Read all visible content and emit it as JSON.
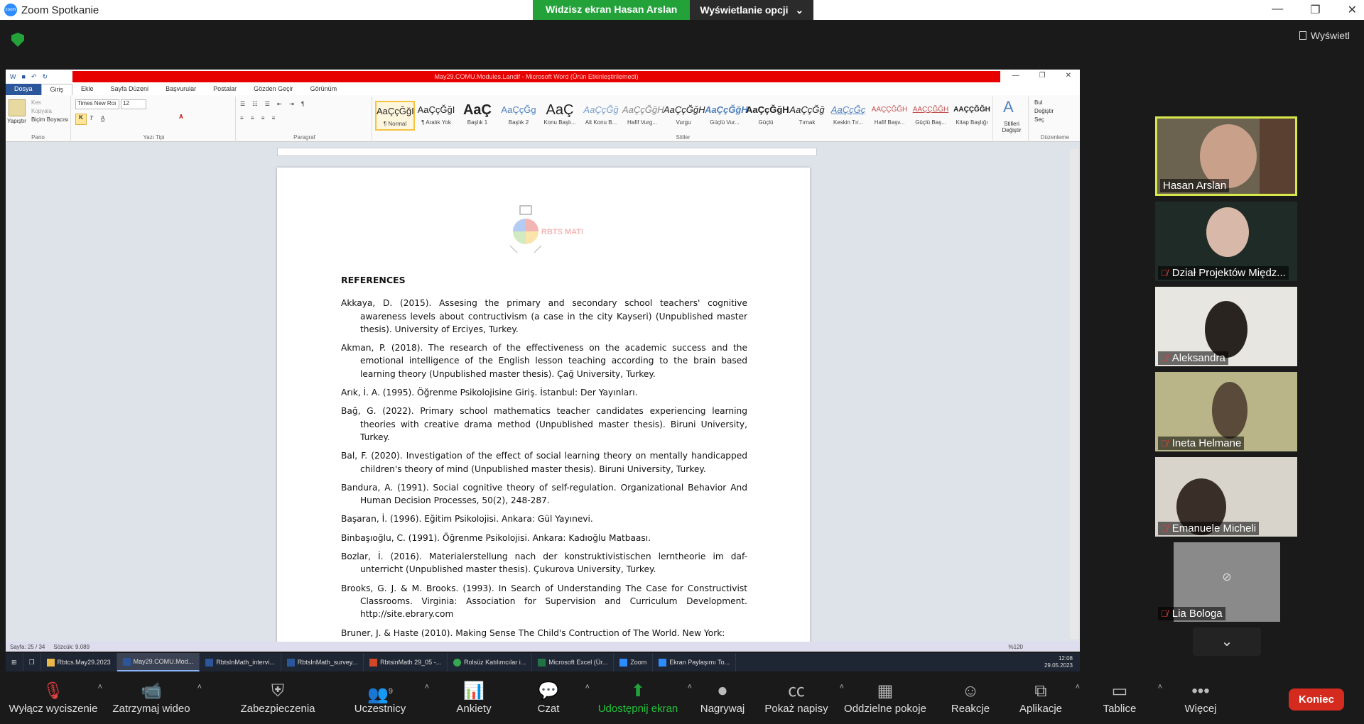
{
  "app": {
    "title": "Zoom Spotkanie"
  },
  "share_banner": {
    "viewing": "Widzisz ekran Hasan Arslan",
    "options": "Wyświetlanie opcji"
  },
  "view_button": "Wyświetl",
  "word": {
    "title": "May29.COMU.Modules.Landif - Microsoft Word (Ürün Etkinleştirilemedi)",
    "tabs": [
      "Dosya",
      "Giriş",
      "Ekle",
      "Sayfa Düzeni",
      "Başvurular",
      "Postalar",
      "Gözden Geçir",
      "Görünüm"
    ],
    "clipboard": {
      "paste": "Yapıştır",
      "cut": "Kes",
      "copy": "Kopyala",
      "format_painter": "Biçim Boyacısı",
      "group": "Pano"
    },
    "font": {
      "name": "Times New Roı",
      "size": "12",
      "group": "Yazı Tipi"
    },
    "paragraph_group": "Paragraf",
    "styles": [
      {
        "preview": "AaÇçĞğI",
        "name": "¶ Normal"
      },
      {
        "preview": "AaÇçĞğI",
        "name": "¶ Aralık Yok"
      },
      {
        "preview": "AaÇ",
        "name": "Başlık 1"
      },
      {
        "preview": "AaÇçĞg",
        "name": "Başlık 2"
      },
      {
        "preview": "AaÇ",
        "name": "Konu Başlı..."
      },
      {
        "preview": "AaÇçĞğ",
        "name": "Alt Konu B..."
      },
      {
        "preview": "AaÇçĞğH",
        "name": "Hafif Vurg..."
      },
      {
        "preview": "AaÇçĞğH",
        "name": "Vurgu"
      },
      {
        "preview": "AaÇçĞğH",
        "name": "Güçlü Vur..."
      },
      {
        "preview": "AaÇçĞğH",
        "name": "Güçlü"
      },
      {
        "preview": "AaÇçĞğ",
        "name": "Tırnak"
      },
      {
        "preview": "AaÇçĞç",
        "name": "Keskin Tır..."
      },
      {
        "preview": "AAÇÇĞĞH",
        "name": "Hafif Başv..."
      },
      {
        "preview": "AAÇÇĞĞH",
        "name": "Güçlü Baş..."
      },
      {
        "preview": "AAÇÇĞĞH",
        "name": "Kitap Başlığı"
      }
    ],
    "styles_group": "Stiller",
    "change_styles": "Stilleri Değiştir",
    "editing": {
      "find": "Bul",
      "replace": "Değiştir",
      "select": "Seç",
      "group": "Düzenleme"
    },
    "logo_text": "RBTS MATH",
    "doc": {
      "heading": "REFERENCES",
      "refs": [
        "Akkaya, D. (2015). Assesing the primary and secondary school teachers' cognitive awareness levels about contructivism (a case in the city Kayseri) (Unpublished master thesis). University of Erciyes, Turkey.",
        "Akman, P. (2018). The research of the effectiveness on the academic success and the emotional intelligence of the English lesson teaching according to the brain based learning theory (Unpublished master thesis). Çağ University, Turkey.",
        "Arık, İ. A. (1995). Öğrenme Psikolojisine Giriş. İstanbul: Der Yayınları.",
        "Bağ, G. (2022). Primary school mathematics teacher candidates experiencing learning theories with creative drama method (Unpublished master thesis). Biruni University, Turkey.",
        "Bal, F. (2020). Investigation of the effect of social learning theory on mentally handicapped children's theory of mind (Unpublished master thesis). Biruni University, Turkey.",
        "Bandura, A. (1991). Social cognitive theory of self-regulation. Organizational Behavior And Human Decision Processes, 50(2), 248-287.",
        "Başaran, İ. (1996). Eğitim Psikolojisi. Ankara: Gül Yayınevi.",
        "Binbaşıoğlu, C. (1991). Öğrenme Psikolojisi. Ankara: Kadıoğlu Matbaası.",
        "Bozlar, İ. (2016). Materialerstellung nach der konstruktivistischen lerntheorie im daf-unterricht (Unpublished master thesis). Çukurova University, Turkey.",
        "Brooks, G. J. & M. Brooks. (1993). In Search of Understanding The Case for Constructivist Classrooms. Virginia: Association for Supervision and Curriculum Development. http://site.ebrary.com",
        "Bruner, J. & Haste (2010). Making Sense The Child's Contruction of The World. New York:"
      ]
    },
    "status": {
      "page": "Sayfa: 25 / 34",
      "words": "Sözcük: 9.089",
      "zoom": "%120"
    }
  },
  "taskbar": {
    "items": [
      "Rbtcs.May29.2023",
      "May29.COMU.Mod...",
      "RbtsInMath_intervi...",
      "RbtsInMath_survey...",
      "RbtsinMath 29_05 -...",
      "Rolsüz Katılımcılar i...",
      "Microsoft Excel (Ür...",
      "Zoom",
      "Ekran Paylaşımı To..."
    ],
    "time": "12:08",
    "date": "29.05.2023"
  },
  "participants": [
    {
      "name": "Hasan Arslan",
      "muted": false,
      "speaking": true
    },
    {
      "name": "Dział Projektów Międz...",
      "muted": true
    },
    {
      "name": "Aleksandra",
      "muted": true
    },
    {
      "name": "Ineta Helmane",
      "muted": true
    },
    {
      "name": "Emanuele Micheli",
      "muted": true
    },
    {
      "name": "Lia Bologa",
      "muted": true
    }
  ],
  "toolbar": {
    "mute": "Wyłącz wyciszenie",
    "video": "Zatrzymaj wideo",
    "security": "Zabezpieczenia",
    "participants": "Uczestnicy",
    "participants_count": "9",
    "polls": "Ankiety",
    "chat": "Czat",
    "share": "Udostępnij ekran",
    "record": "Nagrywaj",
    "captions": "Pokaż napisy",
    "breakout": "Oddzielne pokoje",
    "reactions": "Reakcje",
    "apps": "Aplikacje",
    "whiteboard": "Tablice",
    "more": "Więcej",
    "end": "Koniec"
  },
  "colors": {
    "zoom_blue": "#2d8cff",
    "share_green": "#23a23a",
    "end_red": "#d52b1e",
    "speaker_border": "#d6e84b",
    "word_blue": "#2b579a"
  }
}
